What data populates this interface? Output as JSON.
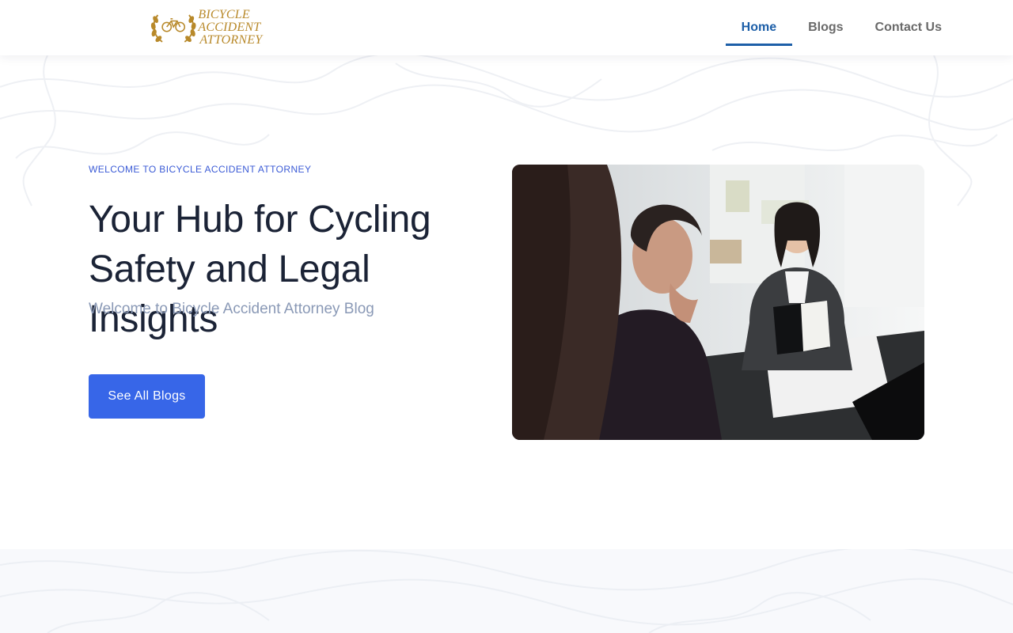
{
  "header": {
    "logo": {
      "line1": "BICYCLE ACCIDENT",
      "line2": "ATTORNEY"
    },
    "nav": [
      {
        "label": "Home",
        "active": true
      },
      {
        "label": "Blogs",
        "active": false
      },
      {
        "label": "Contact Us",
        "active": false
      }
    ]
  },
  "hero": {
    "eyebrow": "WELCOME TO BICYCLE ACCIDENT ATTORNEY",
    "title": "Your Hub for Cycling Safety and Legal Insights",
    "subtitle": "Welcome to Bicycle Accident Attorney Blog",
    "cta_label": "See All Blogs"
  },
  "colors": {
    "accent": "#3766e8",
    "nav_active": "#1d5fa8",
    "logo_gold": "#b8892a",
    "heading": "#1b2336",
    "muted": "#8a99b6"
  }
}
